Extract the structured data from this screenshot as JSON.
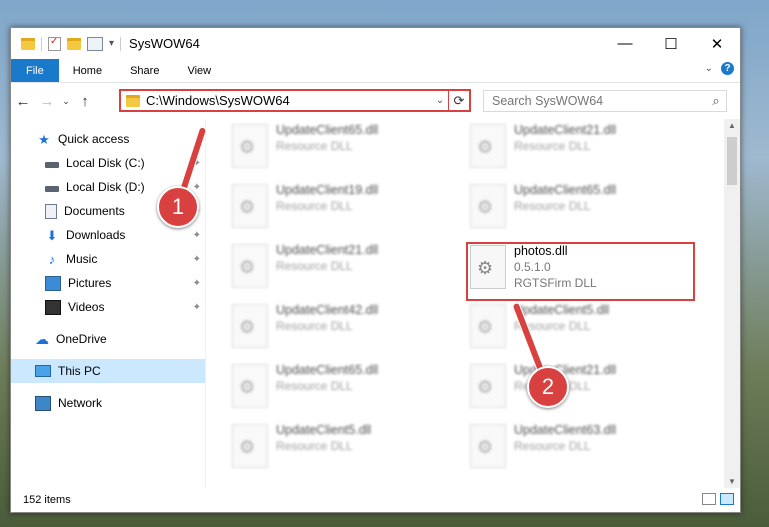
{
  "window": {
    "title": "SysWOW64"
  },
  "ribbon": {
    "tabs": [
      {
        "label": "File"
      },
      {
        "label": "Home"
      },
      {
        "label": "Share"
      },
      {
        "label": "View"
      }
    ]
  },
  "navbar": {
    "address": "C:\\Windows\\SysWOW64",
    "search_placeholder": "Search SysWOW64"
  },
  "sidebar": {
    "items": [
      {
        "label": "Quick access",
        "icon": "star-icon",
        "pinned": false
      },
      {
        "label": "Local Disk (C:)",
        "icon": "drive-icon",
        "pinned": true
      },
      {
        "label": "Local Disk (D:)",
        "icon": "drive-icon",
        "pinned": true
      },
      {
        "label": "Documents",
        "icon": "documents-icon",
        "pinned": true
      },
      {
        "label": "Downloads",
        "icon": "download-icon",
        "pinned": true
      },
      {
        "label": "Music",
        "icon": "music-icon",
        "pinned": true
      },
      {
        "label": "Pictures",
        "icon": "pictures-icon",
        "pinned": true
      },
      {
        "label": "Videos",
        "icon": "videos-icon",
        "pinned": true
      },
      {
        "label": "OneDrive",
        "icon": "cloud-icon",
        "pinned": false
      },
      {
        "label": "This PC",
        "icon": "computer-icon",
        "pinned": false,
        "selected": true
      },
      {
        "label": "Network",
        "icon": "network-icon",
        "pinned": false
      }
    ]
  },
  "files": [
    {
      "name": "UpdateClient65.dll",
      "sub1": "Resource DLL",
      "sub2": ""
    },
    {
      "name": "UpdateClient21.dll",
      "sub1": "Resource DLL",
      "sub2": ""
    },
    {
      "name": "UpdateClient19.dll",
      "sub1": "Resource DLL",
      "sub2": ""
    },
    {
      "name": "UpdateClient65.dll",
      "sub1": "Resource DLL",
      "sub2": ""
    },
    {
      "name": "UpdateClient21.dll",
      "sub1": "Resource DLL",
      "sub2": ""
    },
    {
      "name": "photos.dll",
      "sub1": "0.5.1.0",
      "sub2": "RGTSFirm DLL"
    },
    {
      "name": "UpdateClient42.dll",
      "sub1": "Resource DLL",
      "sub2": ""
    },
    {
      "name": "UpdateClient5.dll",
      "sub1": "Resource DLL",
      "sub2": ""
    },
    {
      "name": "UpdateClient65.dll",
      "sub1": "Resource DLL",
      "sub2": ""
    },
    {
      "name": "UpdateClient21.dll",
      "sub1": "Resource DLL",
      "sub2": ""
    },
    {
      "name": "UpdateClient5.dll",
      "sub1": "Resource DLL",
      "sub2": ""
    },
    {
      "name": "UpdateClient63.dll",
      "sub1": "Resource DLL",
      "sub2": ""
    }
  ],
  "annotations": [
    {
      "label": "1"
    },
    {
      "label": "2"
    }
  ],
  "status": {
    "count": "152 items"
  },
  "colors": {
    "accent": "#1979ca",
    "highlight": "#d94040",
    "selected": "#cce8ff"
  }
}
